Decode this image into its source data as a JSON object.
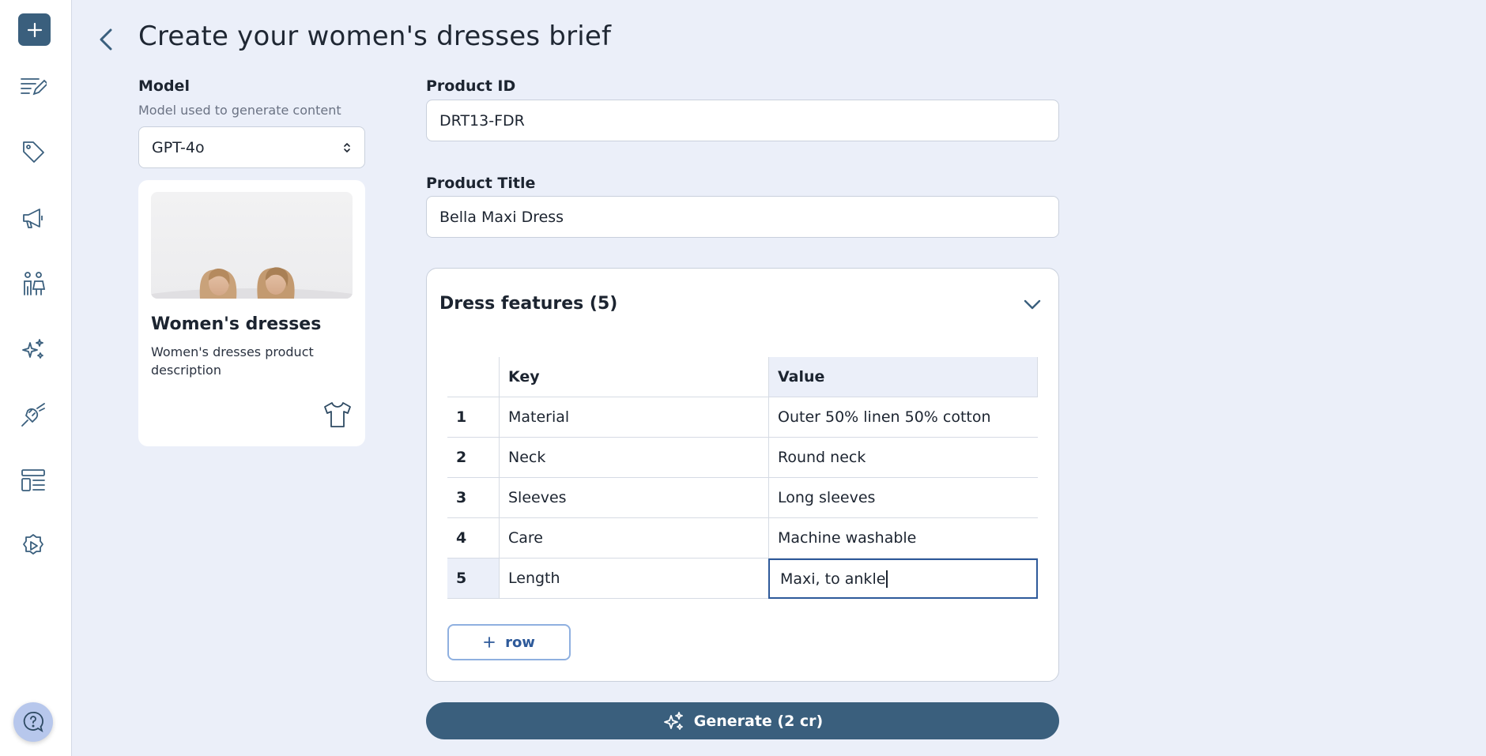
{
  "header": {
    "title": "Create your women's dresses brief"
  },
  "model": {
    "label": "Model",
    "sublabel": "Model used to generate content",
    "selected": "GPT-4o"
  },
  "template_card": {
    "title": "Women's dresses",
    "description": "Women's dresses product description",
    "icon": "tshirt-icon"
  },
  "product_id": {
    "label": "Product ID",
    "value": "DRT13-FDR"
  },
  "product_title": {
    "label": "Product Title",
    "value": "Bella Maxi Dress"
  },
  "features": {
    "title": "Dress features (5)",
    "columns": {
      "key": "Key",
      "value": "Value"
    },
    "rows": [
      {
        "num": "1",
        "key": "Material",
        "value": "Outer 50% linen 50% cotton"
      },
      {
        "num": "2",
        "key": "Neck",
        "value": "Round neck"
      },
      {
        "num": "3",
        "key": "Sleeves",
        "value": "Long sleeves"
      },
      {
        "num": "4",
        "key": "Care",
        "value": "Machine washable"
      },
      {
        "num": "5",
        "key": "Length",
        "value": "Maxi, to ankle"
      }
    ],
    "add_row_label": "row"
  },
  "generate": {
    "label": "Generate (2 cr)"
  },
  "sidebar": {
    "icons": [
      "plus-icon",
      "edit-list-icon",
      "tag-icon",
      "megaphone-icon",
      "people-icon",
      "sparkles-icon",
      "plug-icon",
      "layout-icon",
      "settings-play-icon",
      "help-icon"
    ]
  },
  "colors": {
    "accent": "#3a5f7d",
    "background": "#ebeff9",
    "focus_border": "#2e5a9a"
  }
}
